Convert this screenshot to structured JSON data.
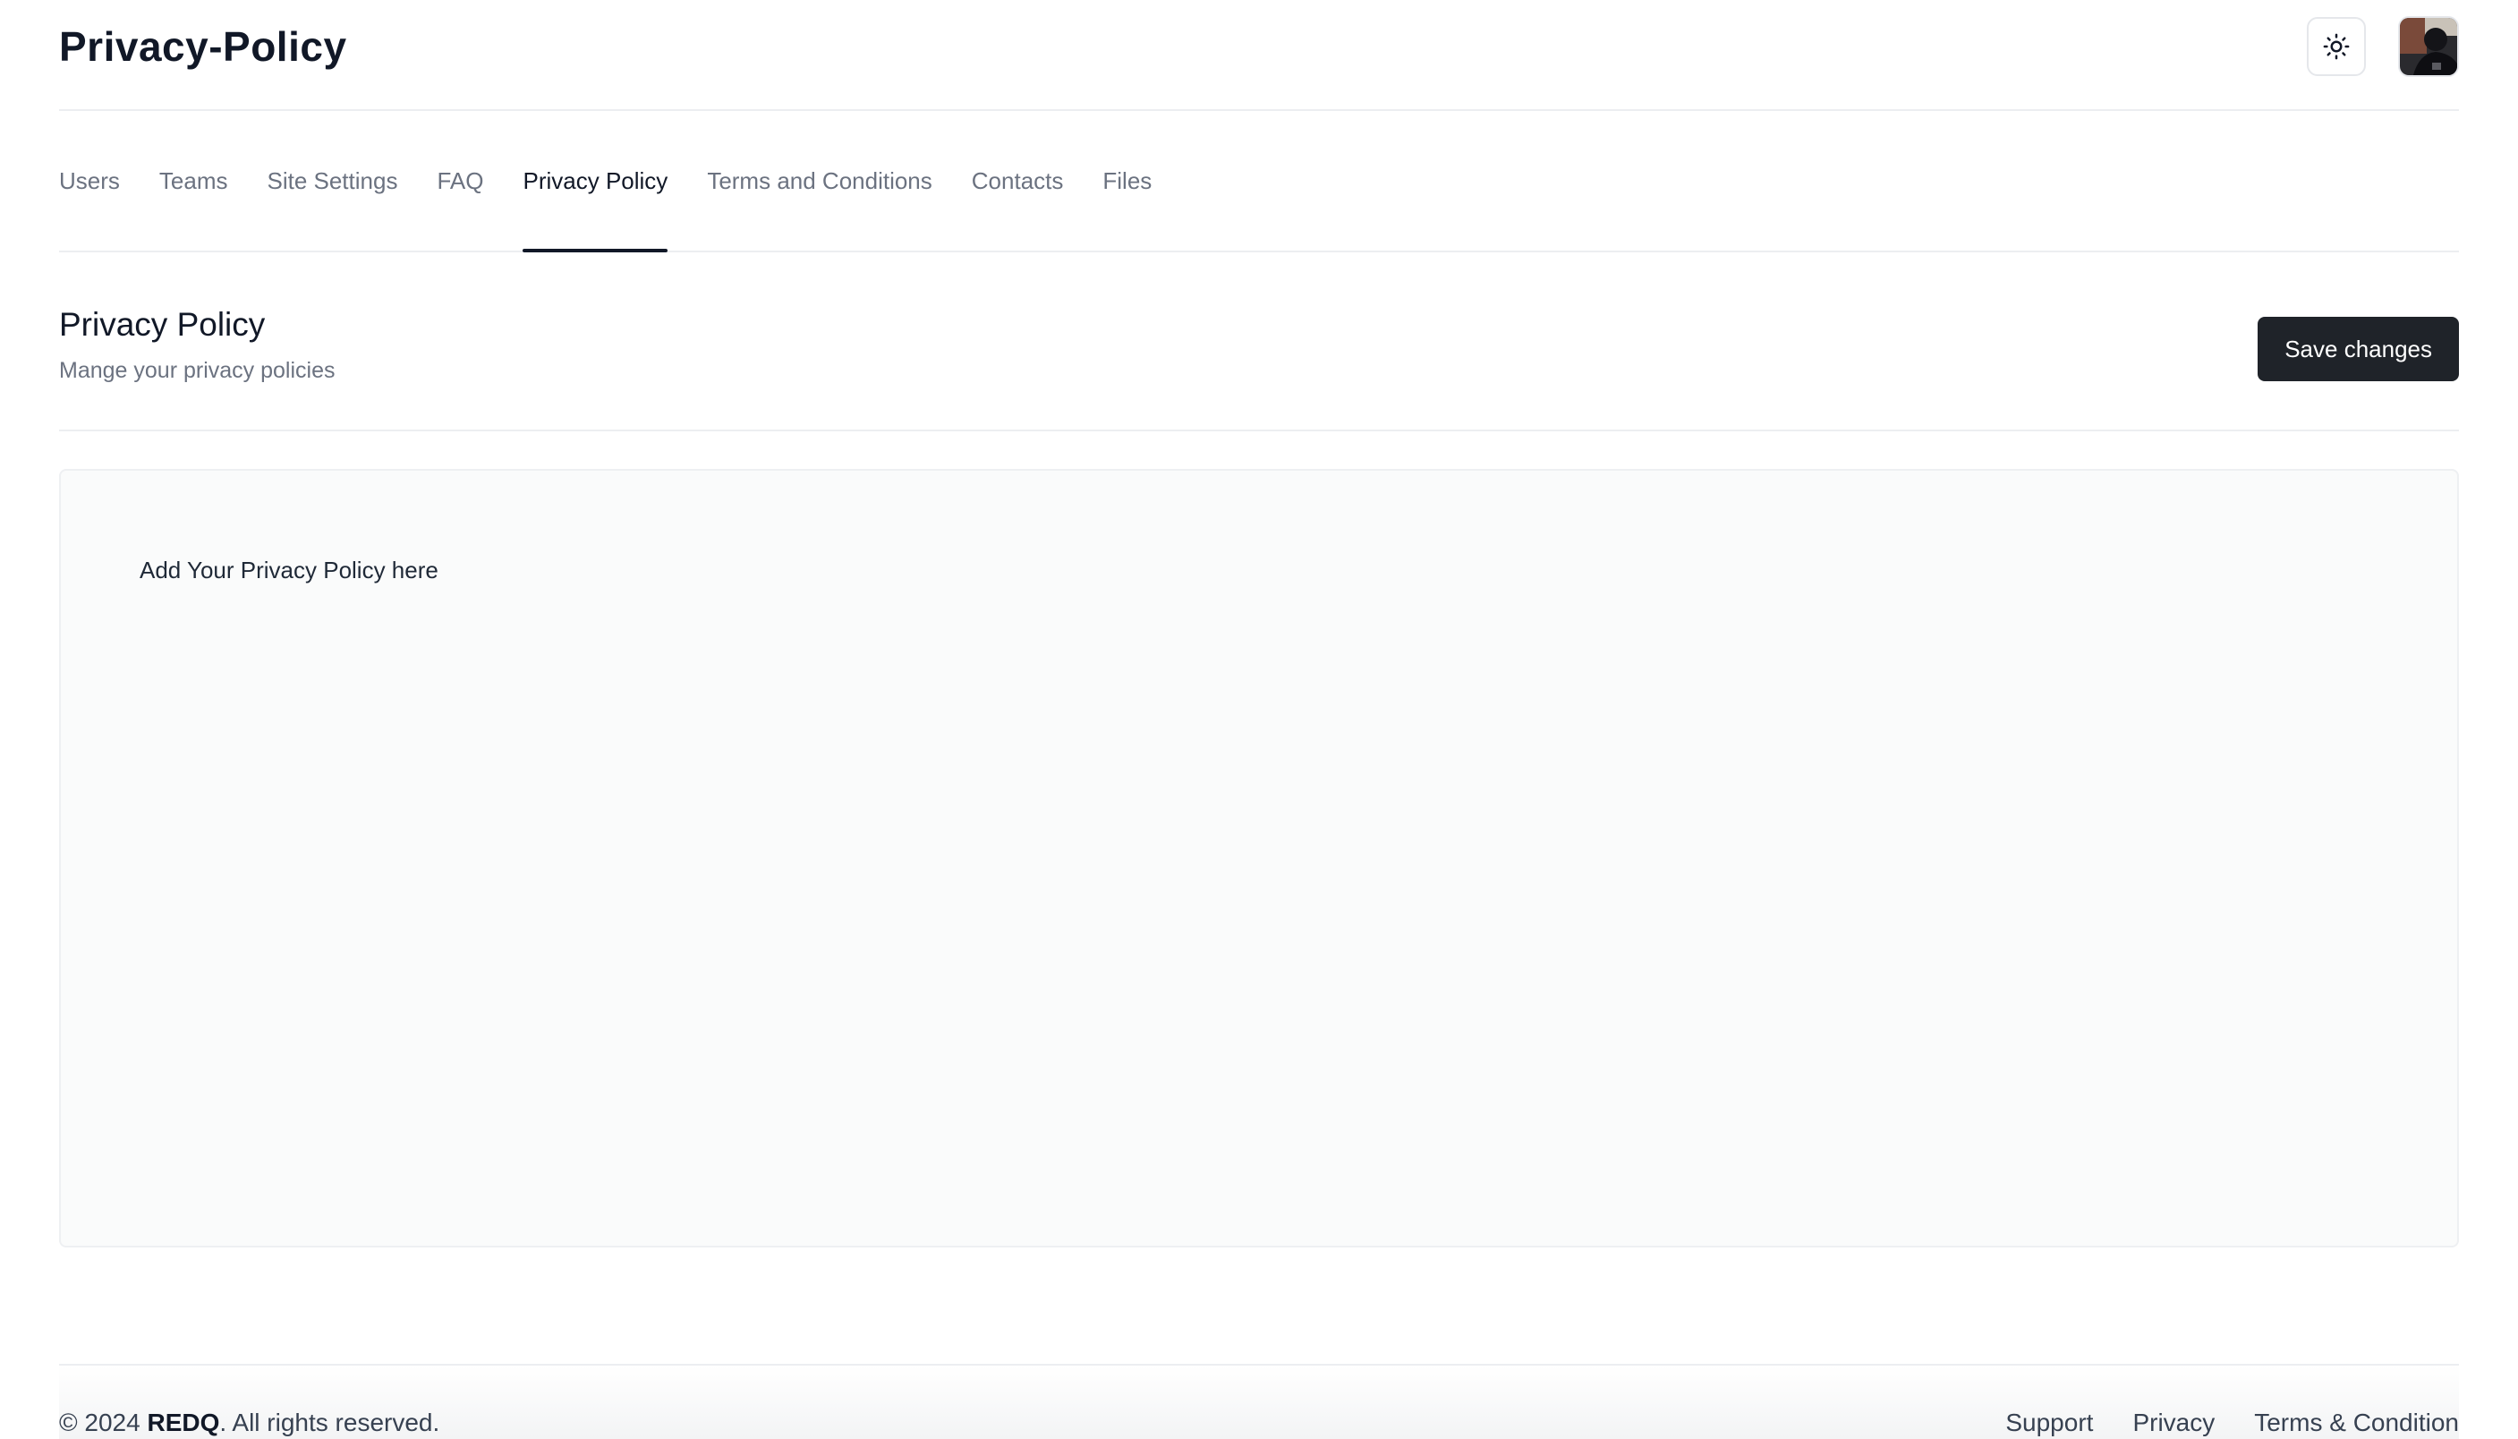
{
  "header": {
    "title": "Privacy-Policy",
    "theme_icon": "sun-icon",
    "avatar_icon": "user-avatar"
  },
  "tabs": [
    {
      "label": "Users",
      "active": false
    },
    {
      "label": "Teams",
      "active": false
    },
    {
      "label": "Site Settings",
      "active": false
    },
    {
      "label": "FAQ",
      "active": false
    },
    {
      "label": "Privacy Policy",
      "active": true
    },
    {
      "label": "Terms and Conditions",
      "active": false
    },
    {
      "label": "Contacts",
      "active": false
    },
    {
      "label": "Files",
      "active": false
    }
  ],
  "section": {
    "title": "Privacy Policy",
    "subtitle": "Mange your privacy policies",
    "save_label": "Save changes"
  },
  "editor": {
    "content": "Add Your Privacy Policy here"
  },
  "footer": {
    "copyright_prefix": "© 2024 ",
    "brand": "REDQ",
    "copyright_suffix": ". All rights reserved.",
    "links": [
      "Support",
      "Privacy",
      "Terms & Condition"
    ]
  },
  "colors": {
    "primary_button": "#1f2329",
    "active_tab": "#111827",
    "muted_text": "#6b7280",
    "editor_bg": "#fafbfb"
  }
}
